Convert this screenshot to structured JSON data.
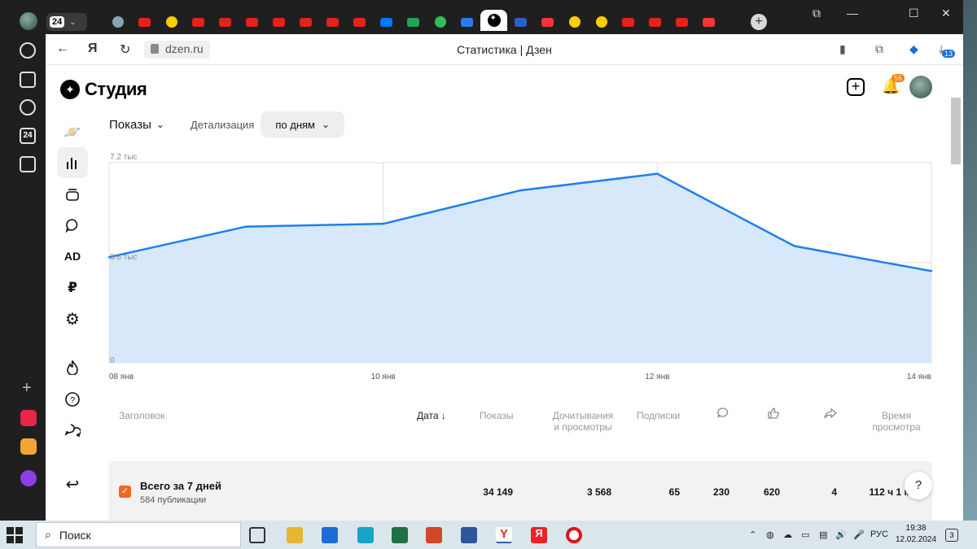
{
  "browser": {
    "tab_count": "24",
    "url": "dzen.ru",
    "page_title": "Статистика | Дзен",
    "ext_badge": "13",
    "tab_icons": [
      "circle-tab-icon",
      "youtube",
      "yandex-music",
      "youtube",
      "youtube",
      "youtube",
      "youtube",
      "youtube",
      "youtube",
      "youtube",
      "vk",
      "green-app",
      "green-circle",
      "blue-chat",
      "dzen-active",
      "mail",
      "yandex-browser",
      "yandex-music",
      "yandex-music",
      "youtube",
      "youtube",
      "youtube",
      "yandex-browser"
    ]
  },
  "header": {
    "logo": "Студия",
    "notif_count": "56"
  },
  "sidebar": {
    "items": [
      {
        "name": "planet-icon",
        "glyph": "🪐"
      },
      {
        "name": "stats-icon",
        "glyph": "📊"
      },
      {
        "name": "publications-icon",
        "glyph": "▤"
      },
      {
        "name": "comments-icon",
        "glyph": "💬"
      },
      {
        "name": "ad-icon",
        "glyph": "AD"
      },
      {
        "name": "ruble-icon",
        "glyph": "₽"
      },
      {
        "name": "settings-icon",
        "glyph": "⚙"
      },
      {
        "name": "fire-icon",
        "glyph": "🔥"
      },
      {
        "name": "help-icon",
        "glyph": "?"
      },
      {
        "name": "chat-icon",
        "glyph": "💬"
      },
      {
        "name": "back-icon",
        "glyph": "↩"
      }
    ]
  },
  "filters": {
    "metric": "Показы",
    "detail_label": "Детализация",
    "detail_value": "по дням"
  },
  "chart_data": {
    "type": "area",
    "y_ticks": [
      "7.2 тыс",
      "3.6 тыс",
      "0"
    ],
    "ylim": [
      0,
      7200
    ],
    "x_ticks": [
      "08 янв",
      "10 янв",
      "12 янв",
      "14 янв"
    ],
    "x": [
      "08 янв",
      "09 янв",
      "10 янв",
      "11 янв",
      "12 янв",
      "13 янв",
      "14 янв"
    ],
    "values": [
      3800,
      4900,
      5000,
      6200,
      6800,
      4200,
      3300
    ],
    "color": "#1e7ff0",
    "fill": "#d7e8fb"
  },
  "table": {
    "headers": {
      "title": "Заголовок",
      "date": "Дата",
      "date_sort": "↓",
      "views": "Показы",
      "reads_1": "Дочитывания",
      "reads_2": "и просмотры",
      "subs": "Подписки",
      "time_1": "Время",
      "time_2": "просмотра"
    },
    "total": {
      "title": "Всего за 7 дней",
      "sub": "584 публикации",
      "views": "34 149",
      "reads": "3 568",
      "subs": "65",
      "comments": "230",
      "likes": "620",
      "shares": "4",
      "time": "112 ч 1 мин"
    }
  },
  "taskbar": {
    "search": "Поиск",
    "lang": "РУС",
    "time": "19:38",
    "date": "12.02.2024",
    "notifications": "3"
  }
}
